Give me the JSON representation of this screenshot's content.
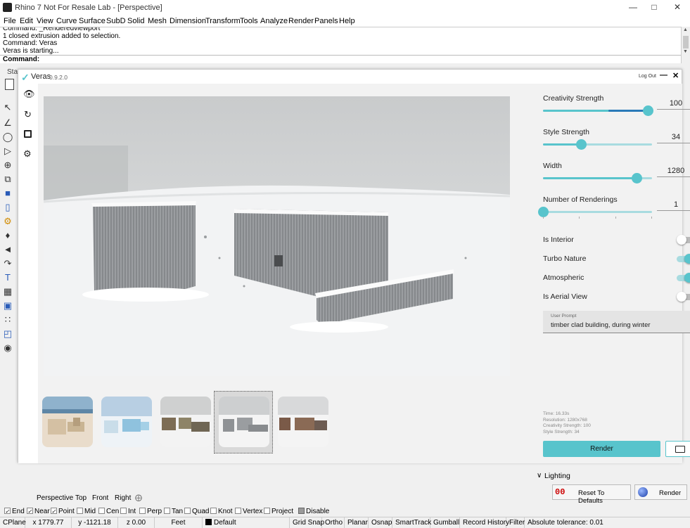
{
  "window": {
    "title": "Rhino 7 Not For Resale Lab - [Perspective]"
  },
  "menu": [
    "File",
    "Edit",
    "View",
    "Curve",
    "Surface",
    "SubD",
    "Solid",
    "Mesh",
    "Dimension",
    "Transform",
    "Tools",
    "Analyze",
    "Render",
    "Panels",
    "Help"
  ],
  "command_history": [
    "Command: _Renderedviewport",
    "1 closed extrusion added to selection.",
    "Command: Veras",
    "Veras is starting..."
  ],
  "command_prompt": "Command:",
  "toolbar_tab_partial": "Sta",
  "veras": {
    "app_name": "Veras",
    "version": "0.9.2.0",
    "logout": "Log Out",
    "settings": {
      "creativity": {
        "label": "Creativity Strength",
        "value": "100",
        "fraction": 0.96,
        "segment_from": 0.6
      },
      "style": {
        "label": "Style Strength",
        "value": "34",
        "fraction": 0.35
      },
      "width": {
        "label": "Width",
        "value": "1280",
        "fraction": 0.86
      },
      "renderings": {
        "label": "Number of Renderings",
        "value": "1",
        "fraction": 0.0
      }
    },
    "toggles": {
      "interior": {
        "label": "Is Interior",
        "on": false
      },
      "turbo": {
        "label": "Turbo Nature",
        "on": true
      },
      "atmospheric": {
        "label": "Atmospheric",
        "on": true
      },
      "aerial": {
        "label": "Is Aerial View",
        "on": false
      }
    },
    "prompt": {
      "label": "User Prompt",
      "value": "timber clad building, during winter"
    },
    "stats": {
      "time": "Time: 16.33s",
      "resolution": "Resolution: 1280x768",
      "creativity": "Creativity Strength: 100",
      "style": "Style Strength: 34"
    },
    "render_label": "Render",
    "thumbnails_count": 5,
    "selected_thumbnail": 4
  },
  "viewport_tabs": [
    "Perspective",
    "Top",
    "Front",
    "Right"
  ],
  "panels": {
    "lighting": "Lighting",
    "reset": "Reset To Defaults",
    "render": "Render"
  },
  "osnaps": [
    {
      "label": "End",
      "checked": true
    },
    {
      "label": "Near",
      "checked": true
    },
    {
      "label": "Point",
      "checked": true
    },
    {
      "label": "Mid",
      "checked": false
    },
    {
      "label": "Cen",
      "checked": false
    },
    {
      "label": "Int",
      "checked": false
    },
    {
      "label": "Perp",
      "checked": false
    },
    {
      "label": "Tan",
      "checked": false
    },
    {
      "label": "Quad",
      "checked": false
    },
    {
      "label": "Knot",
      "checked": false
    },
    {
      "label": "Vertex",
      "checked": false
    },
    {
      "label": "Project",
      "checked": false
    },
    {
      "label": "Disable",
      "checked": false
    }
  ],
  "status": {
    "cplane": "CPlane",
    "x": "x 1779.77",
    "y": "y -1121.18",
    "z": "z 0.00",
    "units": "Feet",
    "layer": "Default",
    "buttons": [
      "Grid Snap",
      "Ortho",
      "Planar",
      "Osnap",
      "SmartTrack",
      "Gumball",
      "Record History",
      "Filter"
    ],
    "tolerance": "Absolute tolerance: 0.01"
  },
  "colors": {
    "accent": "#58c4cc",
    "accent_light": "#a8dbe0",
    "accent_dark": "#2a7ab8"
  }
}
